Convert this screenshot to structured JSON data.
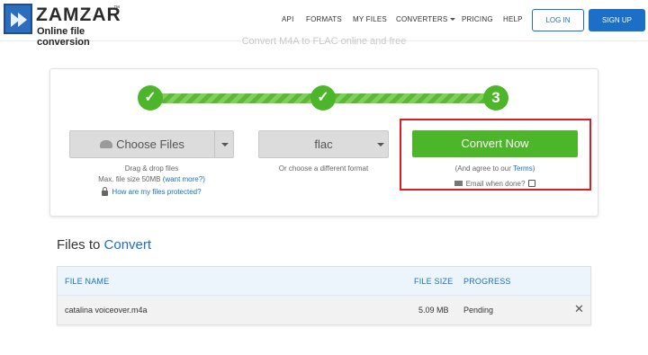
{
  "brand": {
    "name": "ZAMZAR",
    "tm": "™",
    "tagline": "Online file conversion"
  },
  "nav": {
    "api": "API",
    "formats": "FORMATS",
    "my_files": "MY FILES",
    "converters": "CONVERTERS",
    "pricing": "PRICING",
    "help": "HELP",
    "login": "LOG IN",
    "signup": "SIGN UP"
  },
  "subtitle": "Convert M4A to FLAC online and free",
  "steps": {
    "step1": "✓",
    "step2": "✓",
    "step3": "3"
  },
  "choose": {
    "label": "Choose Files",
    "drag_text": "Drag & drop files",
    "max_text": "Max. file size 50MB",
    "want_more": "(want more?)",
    "protected_link": "How are my files protected?"
  },
  "format": {
    "selected": "flac",
    "hint": "Or choose a different format"
  },
  "convert": {
    "label": "Convert Now",
    "agree_prefix": "(And agree to our",
    "terms": "Terms",
    "agree_suffix": ")",
    "email_label": "Email when done?"
  },
  "files": {
    "title_prefix": "Files to",
    "title_accent": "Convert",
    "headers": {
      "name": "FILE NAME",
      "size": "FILE SIZE",
      "progress": "PROGRESS"
    },
    "rows": [
      {
        "name": "catalina voiceover.m4a",
        "size": "5.09 MB",
        "progress": "Pending"
      }
    ]
  },
  "colors": {
    "accent_blue": "#1b6fc6",
    "green": "#4cb52a",
    "highlight_red": "#d81f26"
  }
}
